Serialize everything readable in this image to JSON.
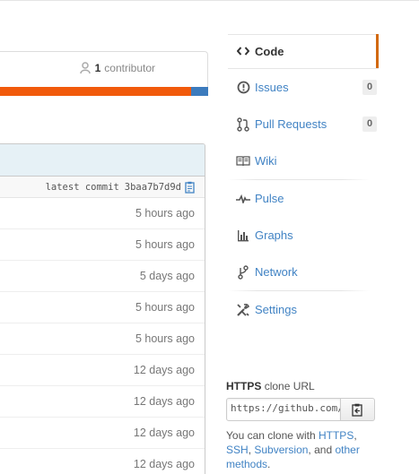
{
  "contributors": {
    "count": "1",
    "label": "contributor",
    "icon": "contributor-icon"
  },
  "language_bar": {
    "colors": [
      "#f15a0b",
      "#3c7bbd"
    ]
  },
  "commit_bar": {
    "prefix": "latest commit",
    "hash": "3baa7b7d9d",
    "icon": "clipboard-icon"
  },
  "files": [
    {
      "age": "5 hours ago"
    },
    {
      "age": "5 hours ago"
    },
    {
      "age": "5 days ago"
    },
    {
      "age": "5 hours ago"
    },
    {
      "age": "5 hours ago"
    },
    {
      "age": "12 days ago"
    },
    {
      "age": "12 days ago"
    },
    {
      "age": "12 days ago"
    },
    {
      "age": "12 days ago"
    }
  ],
  "nav": {
    "code": {
      "label": "Code",
      "icon": "code-icon"
    },
    "issues": {
      "label": "Issues",
      "count": "0",
      "icon": "issues-icon"
    },
    "pulls": {
      "label": "Pull Requests",
      "count": "0",
      "icon": "pull-request-icon"
    },
    "wiki": {
      "label": "Wiki",
      "icon": "wiki-icon"
    },
    "pulse": {
      "label": "Pulse",
      "icon": "pulse-icon"
    },
    "graphs": {
      "label": "Graphs",
      "icon": "graphs-icon"
    },
    "network": {
      "label": "Network",
      "icon": "network-icon"
    },
    "settings": {
      "label": "Settings",
      "icon": "settings-icon"
    }
  },
  "clone": {
    "protocol": "HTTPS",
    "title_suffix": "clone URL",
    "url": "https://github.com/",
    "help_prefix": "You can clone with",
    "https": "HTTPS",
    "comma1": ",",
    "ssh": "SSH",
    "comma2": ",",
    "subversion": "Subversion",
    "and": ", and",
    "other_methods": "other methods",
    "period": "."
  },
  "colors": {
    "accent": "#d26911",
    "link": "#4183c4",
    "header_bg": "#e6f1f6"
  }
}
